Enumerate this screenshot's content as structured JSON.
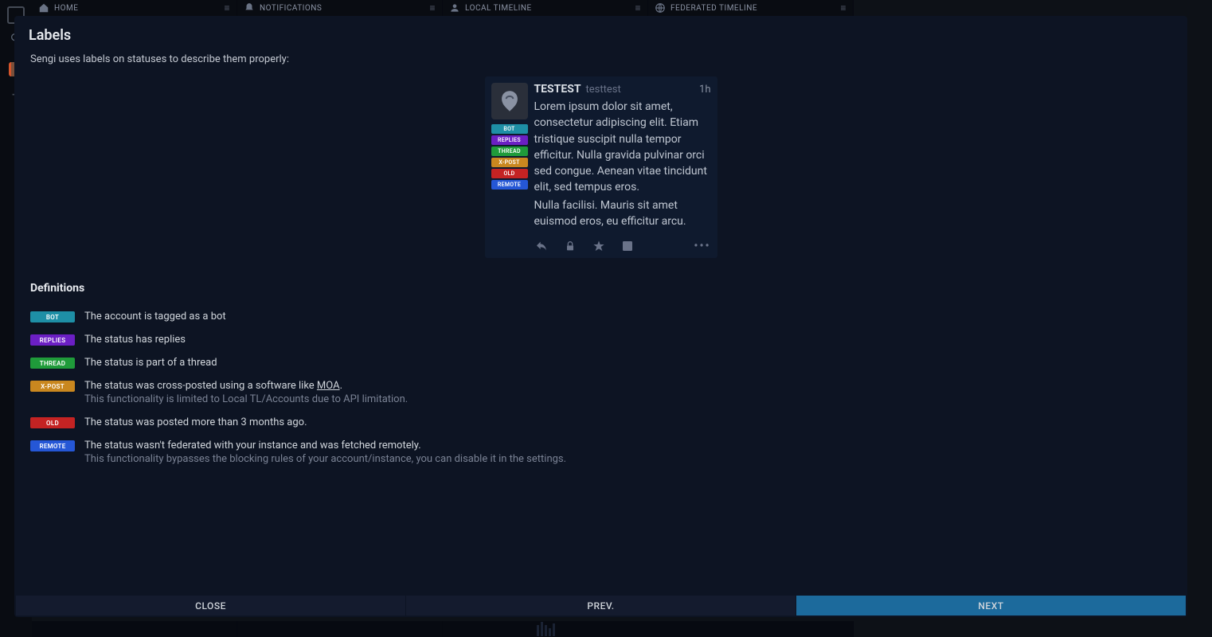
{
  "columns": [
    {
      "title": "HOME"
    },
    {
      "title": "NOTIFICATIONS"
    },
    {
      "title": "LOCAL TIMELINE"
    },
    {
      "title": "FEDERATED TIMELINE"
    }
  ],
  "panel": {
    "title": "Labels",
    "intro": "Sengi uses labels on statuses to describe them properly:"
  },
  "example": {
    "display_name": "TESTEST",
    "handle": "testtest",
    "time": "1h",
    "paragraph1": "Lorem ipsum dolor sit amet, consectetur adipiscing elit. Etiam tristique suscipit nulla tempor efficitur. Nulla gravida pulvinar orci sed congue. Aenean vitae tincidunt elit, sed tempus eros.",
    "paragraph2": "Nulla facilisi. Mauris sit amet euismod eros, eu efficitur arcu.",
    "labels": {
      "bot": "BOT",
      "replies": "REPLIES",
      "thread": "THREAD",
      "xpost": "X-POST",
      "old": "OLD",
      "remote": "REMOTE"
    }
  },
  "definitions": {
    "title": "Definitions",
    "items": {
      "bot": {
        "label": "BOT",
        "text": "The account is tagged as a bot"
      },
      "replies": {
        "label": "REPLIES",
        "text": "The status has replies"
      },
      "thread": {
        "label": "THREAD",
        "text": "The status is part of a thread"
      },
      "xpost": {
        "label": "X-POST",
        "text_pre": "The status was cross-posted using a software like ",
        "link": "MOA",
        "text_post": ".",
        "sub": "This functionality is limited to Local TL/Accounts due to API limitation."
      },
      "old": {
        "label": "OLD",
        "text": "The status was posted more than 3 months ago."
      },
      "remote": {
        "label": "REMOTE",
        "text": "The status wasn't federated with your instance and was fetched remotely.",
        "sub": "This functionality bypasses the blocking rules of your account/instance, you can disable it in the settings."
      }
    }
  },
  "footer": {
    "close": "CLOSE",
    "prev": "PREV.",
    "next": "NEXT"
  }
}
